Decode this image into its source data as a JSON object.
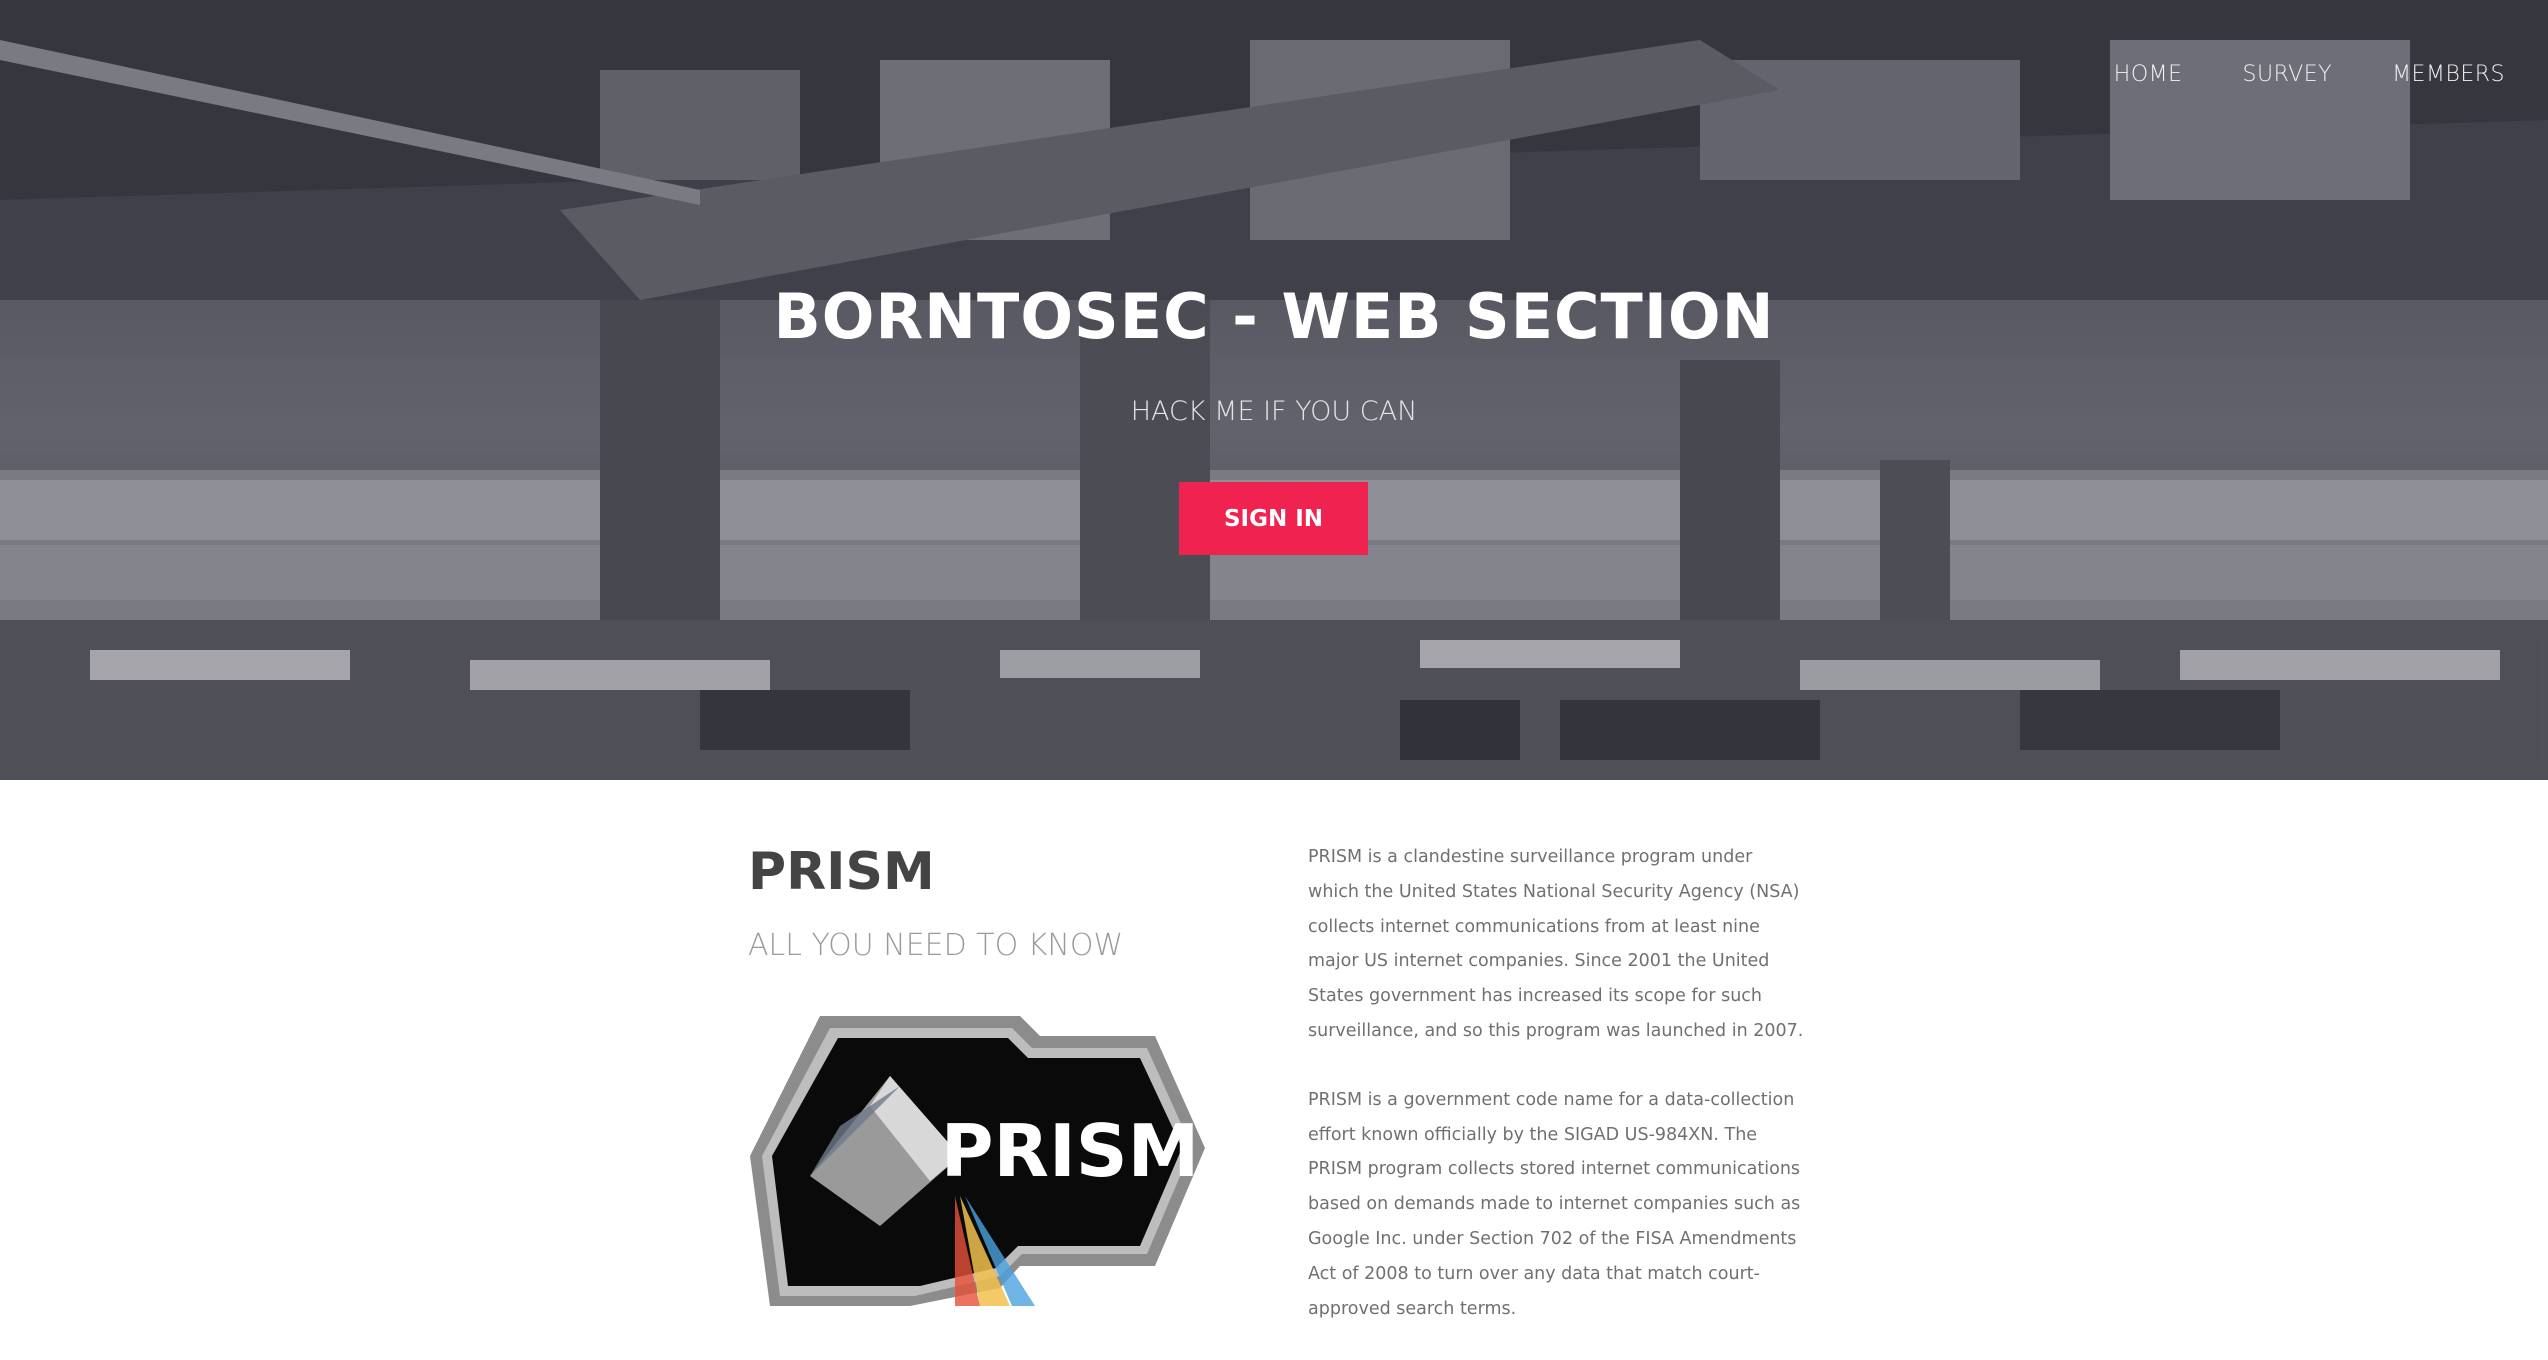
{
  "nav": {
    "items": [
      {
        "label": "HOME"
      },
      {
        "label": "SURVEY"
      },
      {
        "label": "MEMBERS"
      }
    ]
  },
  "hero": {
    "title": "BORNTOSEC - WEB SECTION",
    "subtitle": "HACK ME IF YOU CAN",
    "signin_label": "SIGN IN"
  },
  "about": {
    "title": "PRISM",
    "subtitle": "ALL YOU NEED TO KNOW",
    "logo_text": "PRISM",
    "paragraphs": [
      "PRISM is a clandestine surveillance program under which the United States National Security Agency (NSA) collects internet communications from at least nine major US internet companies. Since 2001 the United States government has increased its scope for such surveillance, and so this program was launched in 2007.",
      "PRISM is a government code name for a data-collection effort known officially by the SIGAD US-984XN. The PRISM program collects stored internet communications based on demands made to internet companies such as Google Inc. under Section 702 of the FISA Amendments Act of 2008 to turn over any data that match court-approved search terms."
    ]
  },
  "colors": {
    "accent": "#f0224f",
    "title_dark": "#444444",
    "subtitle_gray": "#9a9a9a",
    "body_text": "#707070"
  }
}
